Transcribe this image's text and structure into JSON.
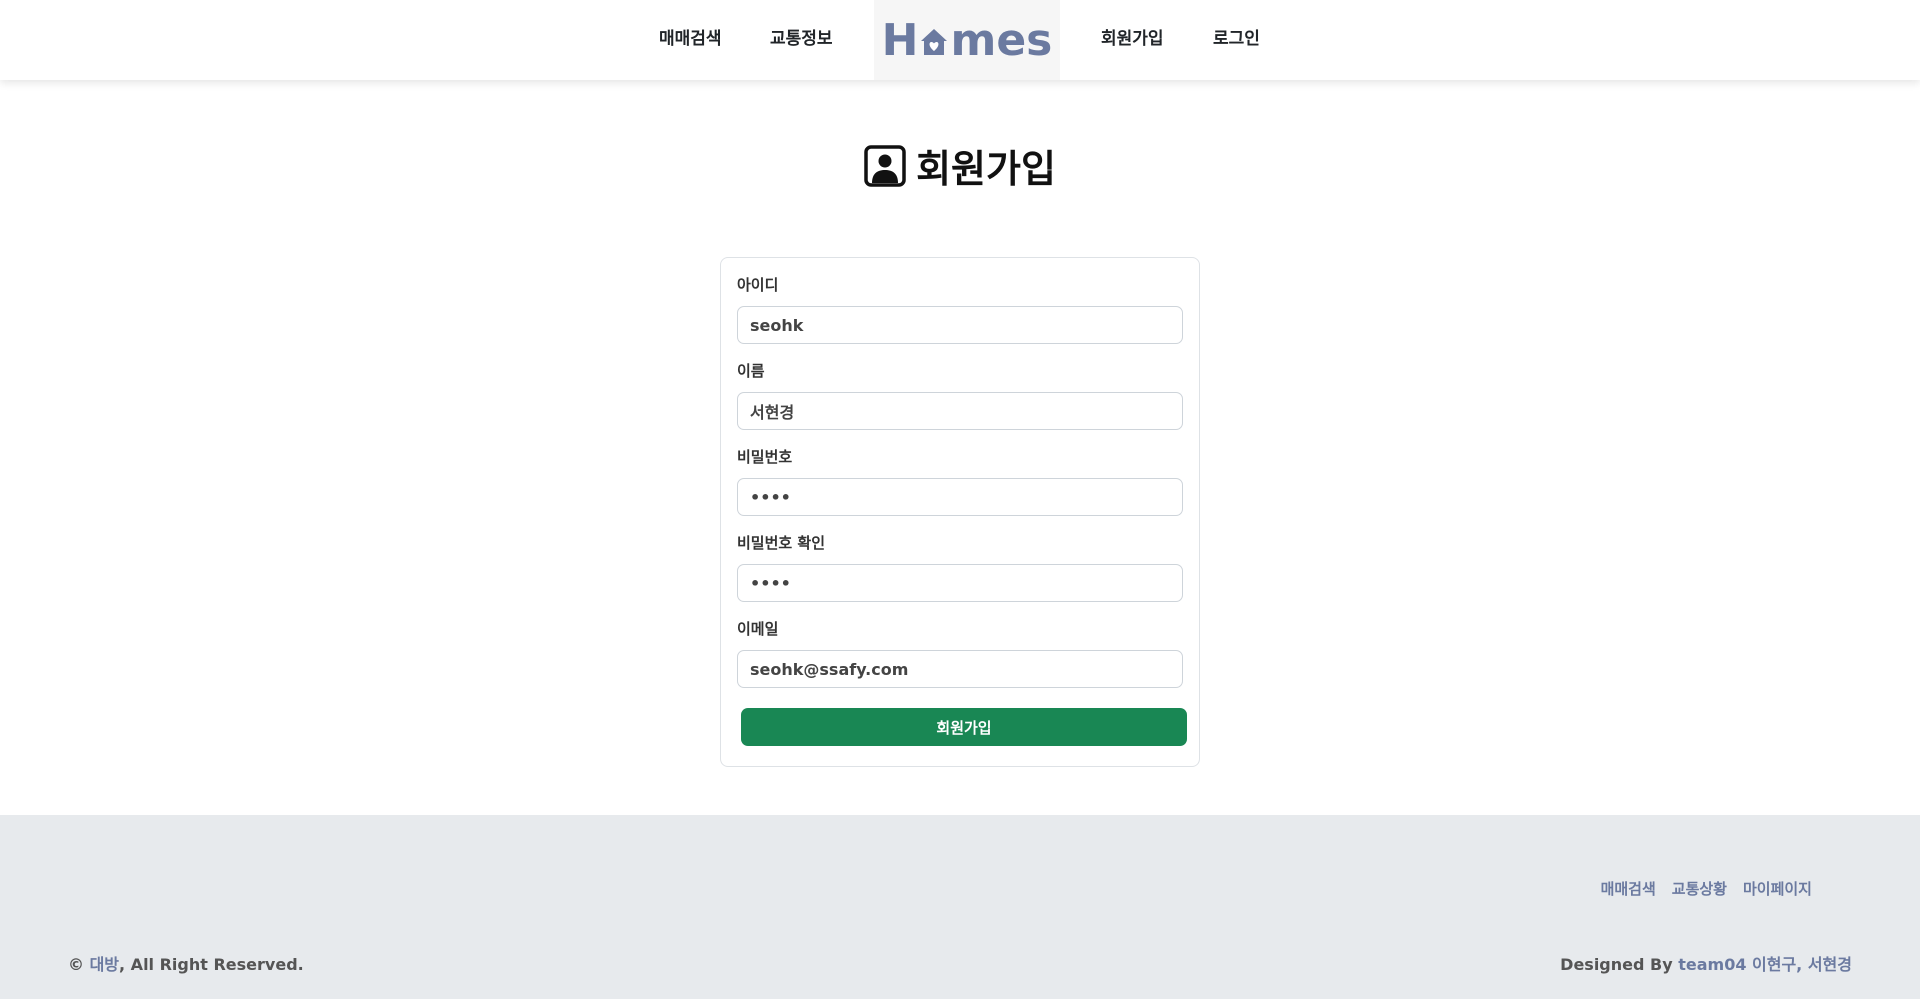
{
  "header": {
    "nav": [
      "매매검색",
      "교통정보",
      "회원가입",
      "로그인"
    ],
    "logo": {
      "left": "H",
      "right": "mes"
    }
  },
  "page_title": "회원가입",
  "form": {
    "fields": [
      {
        "label": "아이디",
        "value": "seohk"
      },
      {
        "label": "이름",
        "value": "서현경"
      },
      {
        "label": "비밀번호",
        "value": "••••"
      },
      {
        "label": "비밀번호 확인",
        "value": "••••"
      },
      {
        "label": "이메일",
        "value": "seohk@ssafy.com"
      }
    ],
    "submit_label": "회원가입"
  },
  "footer": {
    "links": [
      "매매검색",
      "교통상황",
      "마이페이지"
    ],
    "copyright": {
      "symbol": "© ",
      "brand": "대방",
      "rest": ", All Right Reserved."
    },
    "designed": {
      "prefix": "Designed By ",
      "team": "team04 이현구, 서현경"
    }
  },
  "colors": {
    "accent": "#6b7aa0",
    "button": "#198754",
    "footer_bg": "#e7eaed"
  },
  "icons": {
    "title_icon": "person-square-icon",
    "logo_icon": "house-heart-icon"
  }
}
